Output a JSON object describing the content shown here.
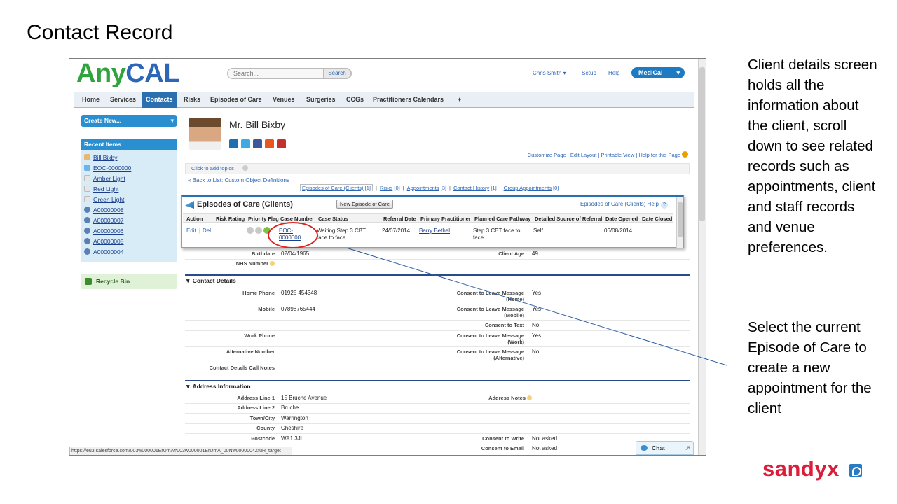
{
  "slide": {
    "title": "Contact Record",
    "note1": "Client details screen holds all the information about the client, scroll down to see related records such as appointments, client and staff records and venue preferences.",
    "note2": "Select the current Episode of Care to create a new appointment for the client",
    "brand": "sandyx"
  },
  "app": {
    "logo_left": "Any",
    "logo_right": "CAL",
    "search_placeholder": "Search...",
    "search_button": "Search",
    "user_menu": "Chris Smith",
    "setup": "Setup",
    "help": "Help",
    "app_switcher": "MediCal",
    "tabs": [
      "Home",
      "Services",
      "Contacts",
      "Risks",
      "Episodes of Care",
      "Venues",
      "Surgeries",
      "CCGs",
      "Practitioners Calendars",
      "+"
    ],
    "active_tab": "Contacts"
  },
  "sidebar": {
    "create_new": "Create New...",
    "recent_title": "Recent Items",
    "recent_items": [
      "Bill Bixby",
      "EOC-0000000",
      "Amber Light",
      "Red Light",
      "Green Light",
      "A00000008",
      "A00000007",
      "A00000006",
      "A00000005",
      "A00000004"
    ],
    "recycle_bin": "Recycle Bin"
  },
  "record": {
    "name": "Mr. Bill Bixby",
    "page_links": "Customize Page | Edit Layout | Printable View | Help for this Page",
    "topics": "Click to add topics",
    "back_link": "« Back to List: Custom Object Definitions",
    "related": [
      {
        "label": "Episodes of Care (Clients)",
        "count": "[1]"
      },
      {
        "label": "Risks",
        "count": "[0]"
      },
      {
        "label": "Appointments",
        "count": "[3]"
      },
      {
        "label": "Contact History",
        "count": "[1]"
      },
      {
        "label": "Group Appointments",
        "count": "[0]"
      }
    ]
  },
  "episodes": {
    "title": "Episodes of Care (Clients)",
    "new_button": "New Episode of Care",
    "help": "Episodes of Care (Clients) Help",
    "columns": [
      "Action",
      "Risk Rating",
      "Priority Flag",
      "Case Number",
      "Case Status",
      "Referral Date",
      "Primary Practitioner",
      "Planned Care Pathway",
      "Detailed Source of Referral",
      "Date Opened",
      "Date Closed"
    ],
    "row": {
      "edit": "Edit",
      "del": "Del",
      "case_number_1": "EOC-",
      "case_number_2": "0000000",
      "case_status_1": "Waiting Step 3 CBT",
      "case_status_2": "face to face",
      "referral_date": "24/07/2014",
      "practitioner": "Barry Bethel",
      "pathway_1": "Step 3 CBT face to",
      "pathway_2": "face",
      "source": "Self",
      "date_opened": "06/08/2014",
      "date_closed": ""
    },
    "flag_colors": [
      "#c8c8c8",
      "#c8c8c8",
      "#7dc242"
    ]
  },
  "details": {
    "birthdate_label": "Birthdate",
    "birthdate": "02/04/1965",
    "client_age_label": "Client Age",
    "client_age": "49",
    "nhs_label": "NHS Number",
    "contact_section": "Contact Details",
    "home_phone_label": "Home Phone",
    "home_phone": "01925 454348",
    "mobile_label": "Mobile",
    "mobile": "07898765444",
    "work_phone_label": "Work Phone",
    "alt_number_label": "Alternative Number",
    "call_notes_label": "Contact Details Call Notes",
    "consent_home_label": "Consent to Leave Message (Home)",
    "consent_home": "Yes",
    "consent_mobile_label": "Consent to Leave Message (Mobile)",
    "consent_mobile": "Yes",
    "consent_text_label": "Consent to Text",
    "consent_text": "No",
    "consent_work_label": "Consent to Leave Message (Work)",
    "consent_work": "Yes",
    "consent_alt_label": "Consent to Leave Message (Alternative)",
    "consent_alt": "No",
    "address_section": "Address Information",
    "addr1_label": "Address Line 1",
    "addr1": "15 Bruche Avenue",
    "addr2_label": "Address Line 2",
    "addr2": "Bruche",
    "town_label": "Town/City",
    "town": "Warrington",
    "county_label": "County",
    "county": "Cheshire",
    "postcode_label": "Postcode",
    "postcode": "WA1 3JL",
    "address_notes_label": "Address Notes",
    "consent_write_label": "Consent to Write",
    "consent_write": "Not asked",
    "consent_email_label": "Consent to Email",
    "consent_email": "Not asked"
  },
  "status_url": "https://eu3.salesforce.com/003w000001ErUmA#003w000001ErUmA_00Nw0000004ZfuR_target",
  "chat": "Chat"
}
